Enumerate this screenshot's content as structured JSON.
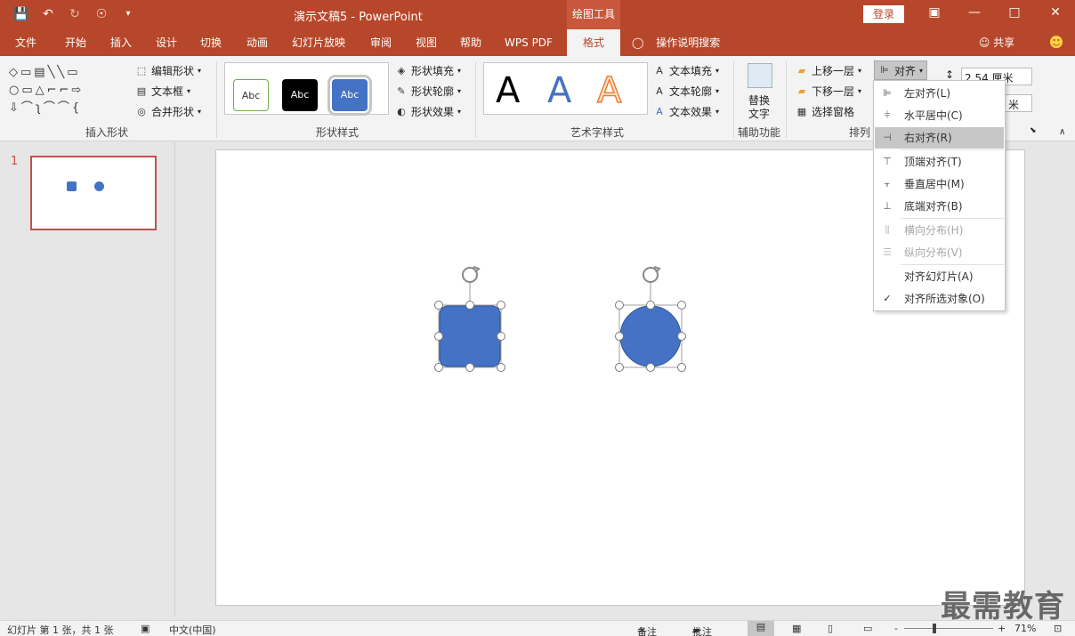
{
  "window": {
    "doc_title": "演示文稿5  -  PowerPoint",
    "context_tab": "绘图工具",
    "login": "登录",
    "qat": [
      "save-icon",
      "undo-icon",
      "redo-icon",
      "touch-mode-icon",
      "customize-icon"
    ]
  },
  "tabs": [
    {
      "label": "文件"
    },
    {
      "label": "开始"
    },
    {
      "label": "插入"
    },
    {
      "label": "设计"
    },
    {
      "label": "切换"
    },
    {
      "label": "动画"
    },
    {
      "label": "幻灯片放映"
    },
    {
      "label": "审阅"
    },
    {
      "label": "视图"
    },
    {
      "label": "帮助"
    },
    {
      "label": "WPS PDF"
    },
    {
      "label": "格式"
    }
  ],
  "tell_me": "操作说明搜索",
  "share": "共享",
  "ribbon": {
    "insert_shapes": {
      "label": "插入形状",
      "edit_shape": "编辑形状",
      "text_box": "文本框",
      "merge_shapes": "合并形状"
    },
    "shape_styles": {
      "label": "形状样式",
      "sample": "Abc",
      "fill": "形状填充",
      "outline": "形状轮廓",
      "effects": "形状效果"
    },
    "wordart": {
      "label": "艺术字样式",
      "letter": "A",
      "text_fill": "文本填充",
      "text_outline": "文本轮廓",
      "text_effects": "文本效果"
    },
    "accessibility": {
      "label": "辅助功能",
      "alt_text_1": "替换",
      "alt_text_2": "文字"
    },
    "arrange": {
      "label": "排列",
      "bring_forward": "上移一层",
      "send_backward": "下移一层",
      "selection_pane": "选择窗格",
      "align": "对齐"
    },
    "size": {
      "height": "2.54 厘米",
      "width": "米"
    }
  },
  "slides": {
    "number": "1"
  },
  "align_menu": [
    {
      "icon": "align-left-icon",
      "label": "左对齐(L)",
      "disabled": false
    },
    {
      "icon": "align-center-icon",
      "label": "水平居中(C)",
      "disabled": false
    },
    {
      "icon": "align-right-icon",
      "label": "右对齐(R)",
      "disabled": false
    },
    {
      "icon": "align-top-icon",
      "label": "顶端对齐(T)",
      "disabled": false
    },
    {
      "icon": "align-middle-icon",
      "label": "垂直居中(M)",
      "disabled": false
    },
    {
      "icon": "align-bottom-icon",
      "label": "底端对齐(B)",
      "disabled": false
    },
    {
      "icon": "distribute-horizontal-icon",
      "label": "横向分布(H)",
      "disabled": true
    },
    {
      "icon": "distribute-vertical-icon",
      "label": "纵向分布(V)",
      "disabled": true
    },
    {
      "icon": "",
      "label": "对齐幻灯片(A)",
      "disabled": false
    },
    {
      "icon": "check-icon",
      "label": "对齐所选对象(O)",
      "disabled": false
    }
  ],
  "status": {
    "slide_info": "幻灯片 第 1 张，共 1 张",
    "language": "中文(中国)",
    "notes": "备注",
    "comments": "批注",
    "zoom": "71%",
    "zoom_minus": "-",
    "zoom_plus": "+"
  },
  "watermark": "最需教育",
  "colors": {
    "accent": "#b7472a",
    "shape_fill": "#4472c4",
    "shape_stroke": "#2f5597"
  }
}
